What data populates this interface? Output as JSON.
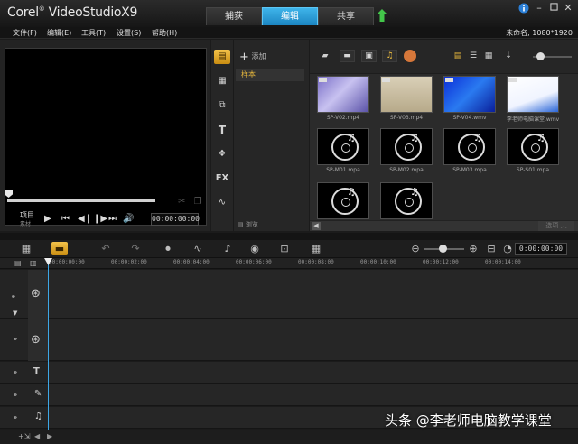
{
  "app": {
    "logo_brand": "Corel",
    "logo_product": "VideoStudio",
    "logo_version": "X9",
    "tabs": [
      "捕获",
      "编辑",
      "共享"
    ],
    "active_tab": "编辑"
  },
  "menu": {
    "items": [
      "文件(F)",
      "编辑(E)",
      "工具(T)",
      "设置(S)",
      "帮助(H)"
    ],
    "project_info": "未命名, 1080*1920"
  },
  "player": {
    "mode_label": "项目",
    "mode_sub": "素材",
    "timecode": "00:00:00:00"
  },
  "library": {
    "add_label": "添加",
    "folder": "样本",
    "browse_label": "浏览",
    "options_label": "选项",
    "items": [
      {
        "caption": "SP-V02.mp4",
        "kind": "video",
        "style": "purple"
      },
      {
        "caption": "SP-V03.mp4",
        "kind": "video",
        "style": "beige"
      },
      {
        "caption": "SP-V04.wmv",
        "kind": "video",
        "style": "blue"
      },
      {
        "caption": "李老师电脑课堂.wmv",
        "kind": "video",
        "style": "white"
      },
      {
        "caption": "SP-M01.mpa",
        "kind": "audio"
      },
      {
        "caption": "SP-M02.mpa",
        "kind": "audio"
      },
      {
        "caption": "SP-M03.mpa",
        "kind": "audio"
      },
      {
        "caption": "SP-S01.mpa",
        "kind": "audio"
      },
      {
        "caption": "",
        "kind": "audio"
      },
      {
        "caption": "",
        "kind": "audio"
      }
    ]
  },
  "timeline": {
    "timecode": "0:00:00:00",
    "ruler": [
      "00:00:00:00",
      "00:00:02:00",
      "00:00:04:00",
      "00:00:06:00",
      "00:00:08:00",
      "00:00:10:00",
      "00:00:12:00",
      "00:00:14:00"
    ]
  },
  "watermark": "头条 @李老师电脑教学课堂",
  "colors": {
    "accent": "#2a9ad6",
    "highlight": "#e8b83c"
  }
}
